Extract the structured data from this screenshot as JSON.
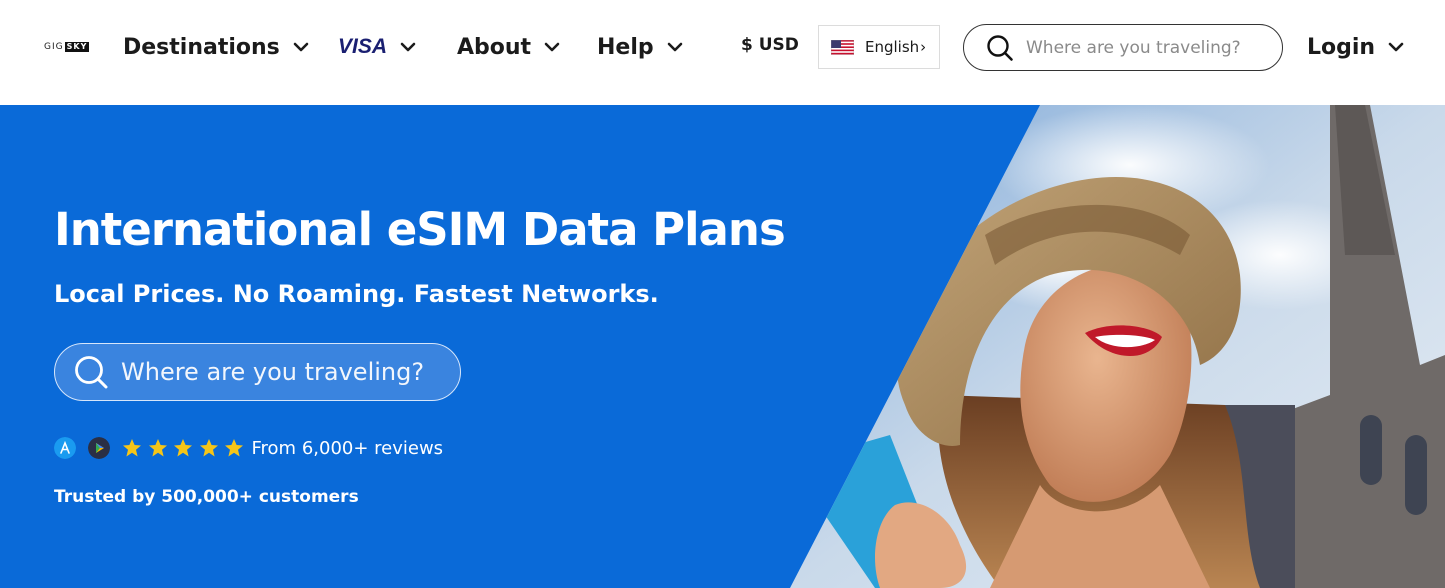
{
  "header": {
    "logo": {
      "part1": "GIG",
      "part2": "SKY"
    },
    "nav": [
      {
        "label": "Destinations"
      },
      {
        "label": "VISA"
      },
      {
        "label": "About"
      },
      {
        "label": "Help"
      }
    ],
    "currency": "$ USD",
    "language": "English",
    "search": {
      "placeholder": "Where are you traveling?"
    },
    "login": "Login"
  },
  "hero": {
    "title": "International eSIM Data Plans",
    "subtitle": "Local Prices. No Roaming. Fastest Networks.",
    "search": {
      "placeholder": "Where are you traveling?"
    },
    "rating": {
      "stars": 5,
      "reviews": "From 6,000+ reviews"
    },
    "trusted": "Trusted by 500,000+ customers"
  },
  "colors": {
    "hero_blue": "#0a6ad8",
    "star_yellow": "#f5c518",
    "visa_blue": "#1a1f71",
    "text_dark": "#1b1b1b"
  },
  "icons": {
    "search": "search-icon",
    "chevron": "chevron-down-icon",
    "flag": "us-flag-icon",
    "app_store": "app-store-icon",
    "google_play": "google-play-icon",
    "star": "star-icon"
  }
}
